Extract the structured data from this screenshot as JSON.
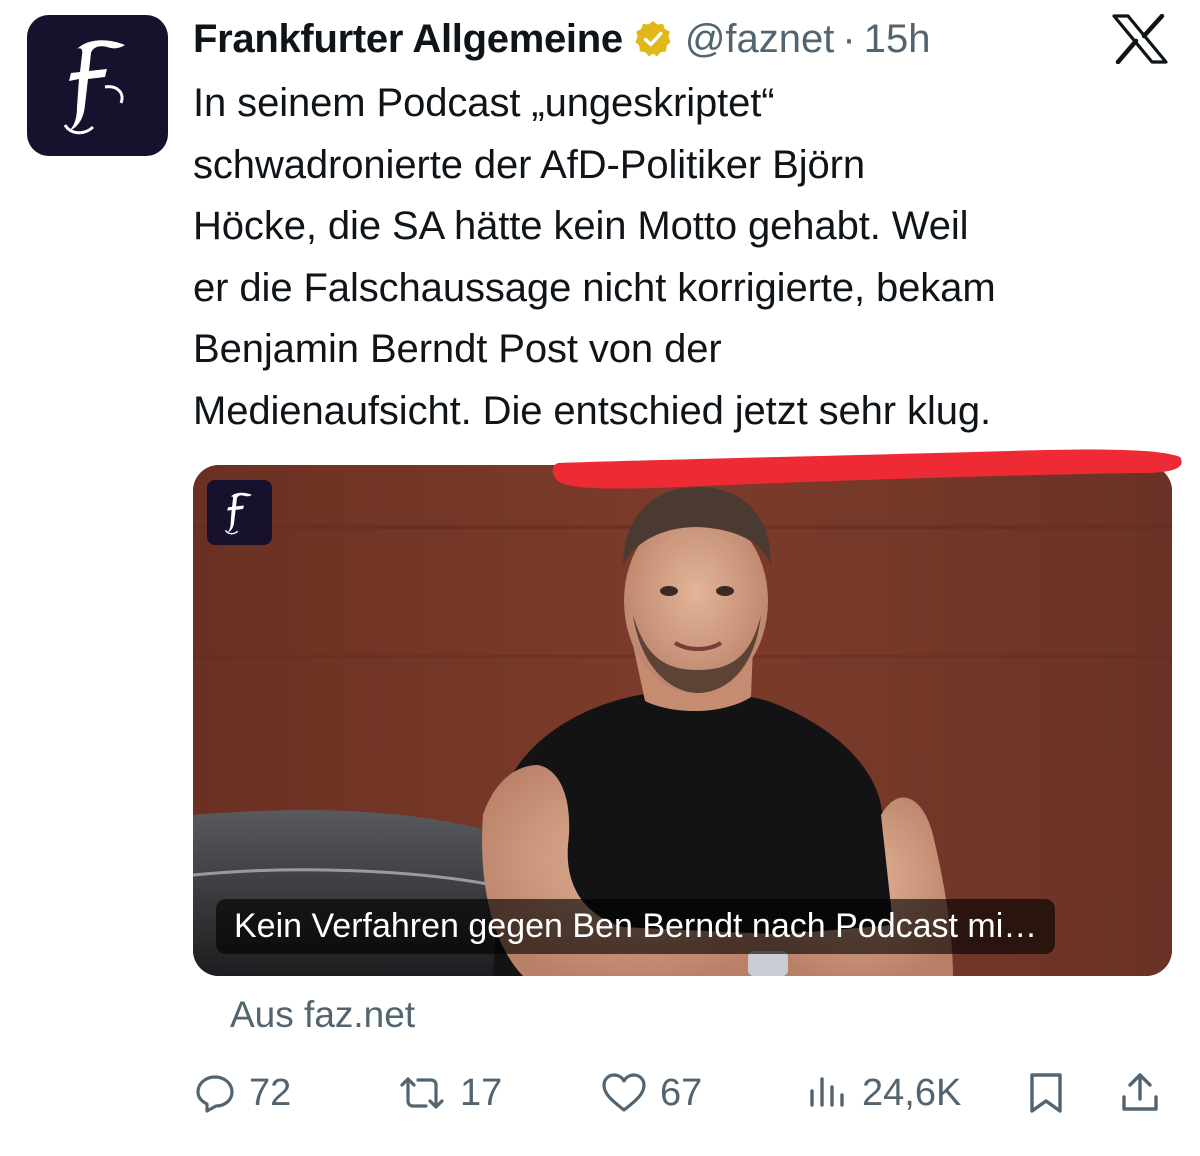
{
  "tweet": {
    "display_name": "Frankfurter Allgemeine",
    "handle": "@faznet",
    "separator": "·",
    "time": "15h",
    "verified_icon": "gold-verified-badge-icon",
    "avatar_icon": "faz-fraktur-f-logo",
    "platform_icon": "x-logo-icon",
    "text_lines": [
      "In seinem Podcast „ungeskriptet“",
      "schwadronierte der AfD-Politiker Björn",
      "Höcke, die SA hätte kein Motto gehabt. Weil",
      "er die Falschaussage nicht korrigierte, bekam",
      "Benjamin Berndt Post von der",
      "Medienaufsicht. Die entschied jetzt sehr klug."
    ],
    "underline_color": "#ee2a35"
  },
  "card": {
    "caption": "Kein Verfahren gegen Ben Berndt nach Podcast mi…",
    "source": "Aus faz.net",
    "badge_icon": "faz-fraktur-f-logo"
  },
  "actions": {
    "reply": {
      "icon": "reply-icon",
      "count": "72"
    },
    "repost": {
      "icon": "repost-icon",
      "count": "17"
    },
    "like": {
      "icon": "heart-icon",
      "count": "67"
    },
    "views": {
      "icon": "views-chart-icon",
      "count": "24,6K"
    },
    "bookmark": {
      "icon": "bookmark-icon"
    },
    "share": {
      "icon": "share-icon"
    }
  },
  "colors": {
    "text": "#0f1419",
    "secondary": "#536471",
    "avatar_bg": "#17112e",
    "verified_gold": "#e2b719"
  }
}
